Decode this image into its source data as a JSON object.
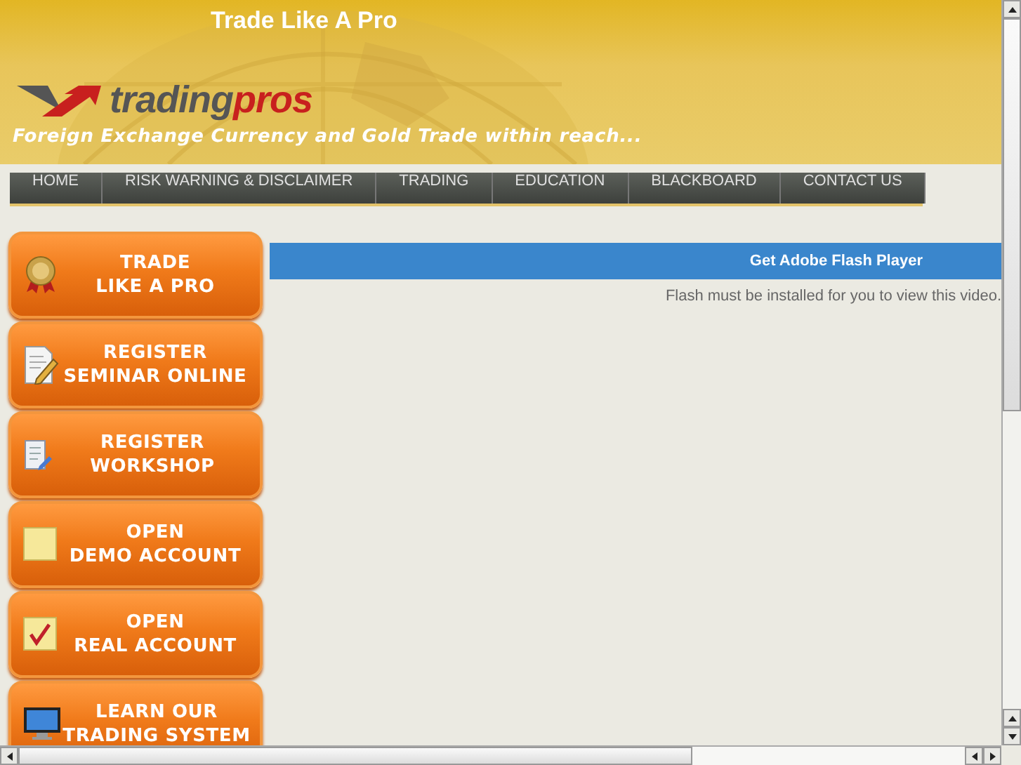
{
  "header": {
    "title": "Trade Like A Pro",
    "logo": {
      "part_1": "trading",
      "part_2": "pros"
    },
    "tagline": "Foreign Exchange Currency and Gold Trade within reach..."
  },
  "nav": [
    {
      "label": "HOME"
    },
    {
      "label": "RISK WARNING & DISCLAIMER"
    },
    {
      "label": "TRADING"
    },
    {
      "label": "EDUCATION"
    },
    {
      "label": "BLACKBOARD"
    },
    {
      "label": "CONTACT US"
    }
  ],
  "side_buttons": [
    {
      "lines": [
        "TRADE",
        "LIKE A PRO"
      ]
    },
    {
      "lines": [
        "REGISTER",
        "SEMINAR ONLINE"
      ]
    },
    {
      "lines": [
        "REGISTER",
        "WORKSHOP"
      ]
    },
    {
      "lines": [
        "OPEN",
        "DEMO ACCOUNT"
      ]
    },
    {
      "lines": [
        "OPEN",
        "REAL ACCOUNT"
      ]
    },
    {
      "lines": [
        "LEARN OUR",
        "TRADING SYSTEM"
      ]
    }
  ],
  "flash": {
    "link": "Get Adobe Flash Player",
    "notice": "Flash must be installed for you to view this video."
  }
}
